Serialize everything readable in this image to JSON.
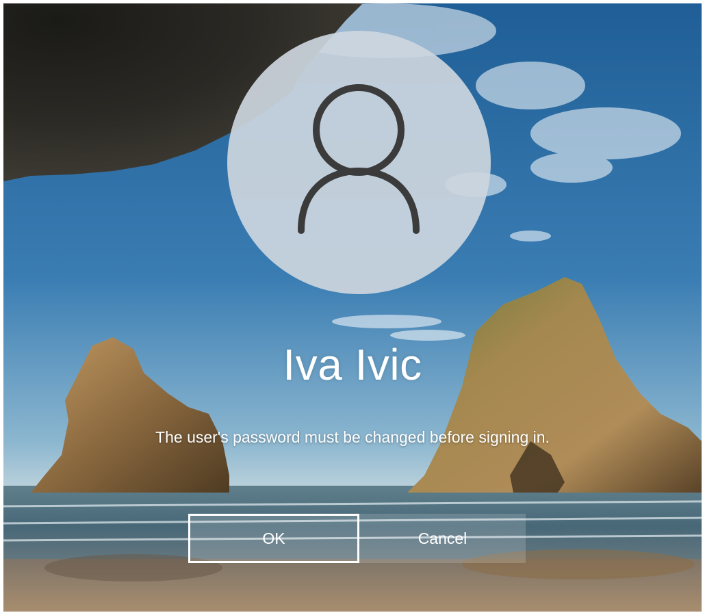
{
  "login": {
    "user_name": "Iva Ivic",
    "message": "The user's password must be changed before signing in.",
    "ok_label": "OK",
    "cancel_label": "Cancel"
  },
  "icons": {
    "avatar": "user-silhouette-icon"
  },
  "colors": {
    "text": "#ffffff",
    "avatar_circle": "#cdd6de",
    "avatar_glyph": "#3b3b3b",
    "focus_border": "#ffffff"
  }
}
